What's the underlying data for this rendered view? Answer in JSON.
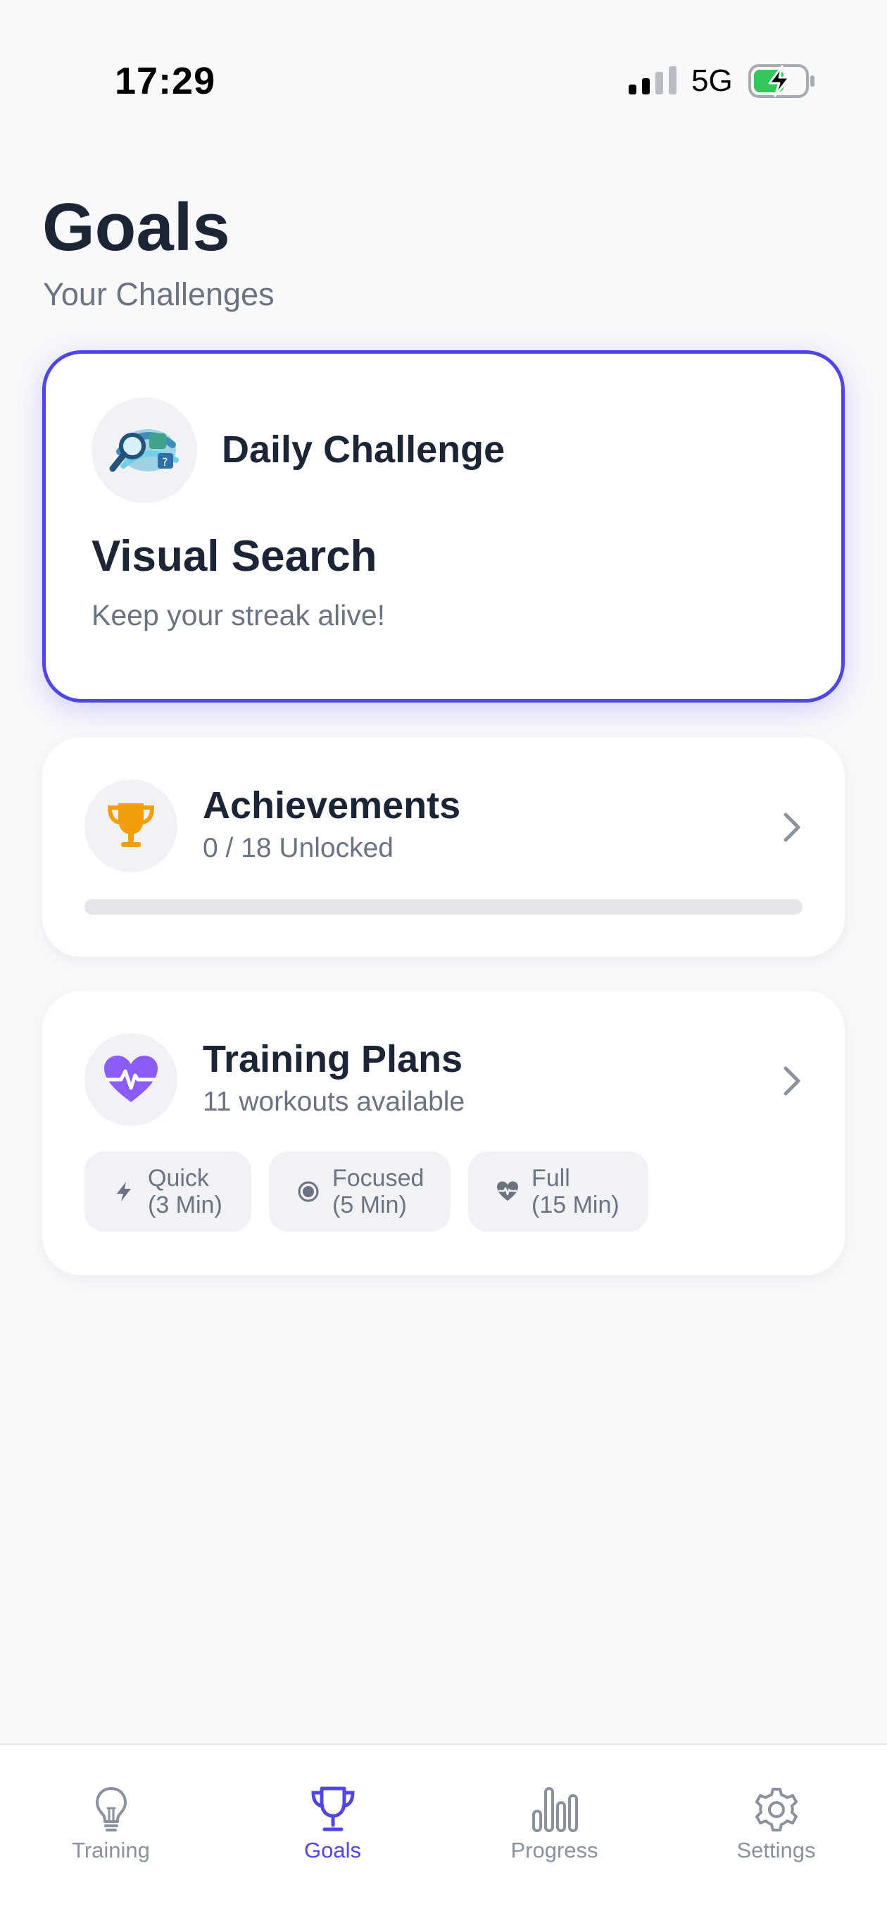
{
  "status_bar": {
    "time": "17:29",
    "network": "5G",
    "signal_icon": "signal-icon",
    "battery_icon": "battery-charging-icon"
  },
  "header": {
    "title": "Goals",
    "subtitle": "Your Challenges"
  },
  "daily_challenge": {
    "heading": "Daily Challenge",
    "name": "Visual Search",
    "description": "Keep your streak alive!",
    "icon": "visual-search-icon",
    "accent": "#4f46e5"
  },
  "achievements": {
    "title": "Achievements",
    "subtitle": "0 / 18 Unlocked",
    "unlocked": 0,
    "total": 18,
    "icon": "trophy-icon",
    "icon_color": "#f59e0b"
  },
  "training_plans": {
    "title": "Training Plans",
    "subtitle": "11 workouts available",
    "icon": "heart-pulse-icon",
    "icon_color": "#8b5cf6",
    "options": [
      {
        "line1": "Quick",
        "line2": "(3 Min)",
        "icon": "bolt-icon"
      },
      {
        "line1": "Focused",
        "line2": "(5 Min)",
        "icon": "target-icon"
      },
      {
        "line1": "Full",
        "line2": "(15 Min)",
        "icon": "heart-pulse-icon"
      }
    ]
  },
  "tab_bar": {
    "active": "Goals",
    "items": [
      {
        "label": "Training",
        "icon": "lightbulb-icon"
      },
      {
        "label": "Goals",
        "icon": "trophy-icon"
      },
      {
        "label": "Progress",
        "icon": "bar-chart-icon"
      },
      {
        "label": "Settings",
        "icon": "gear-icon"
      }
    ]
  },
  "colors": {
    "accent": "#4f46e5",
    "text_primary": "#1c2535",
    "text_secondary": "#6b7380",
    "background": "#f8f9fb"
  }
}
